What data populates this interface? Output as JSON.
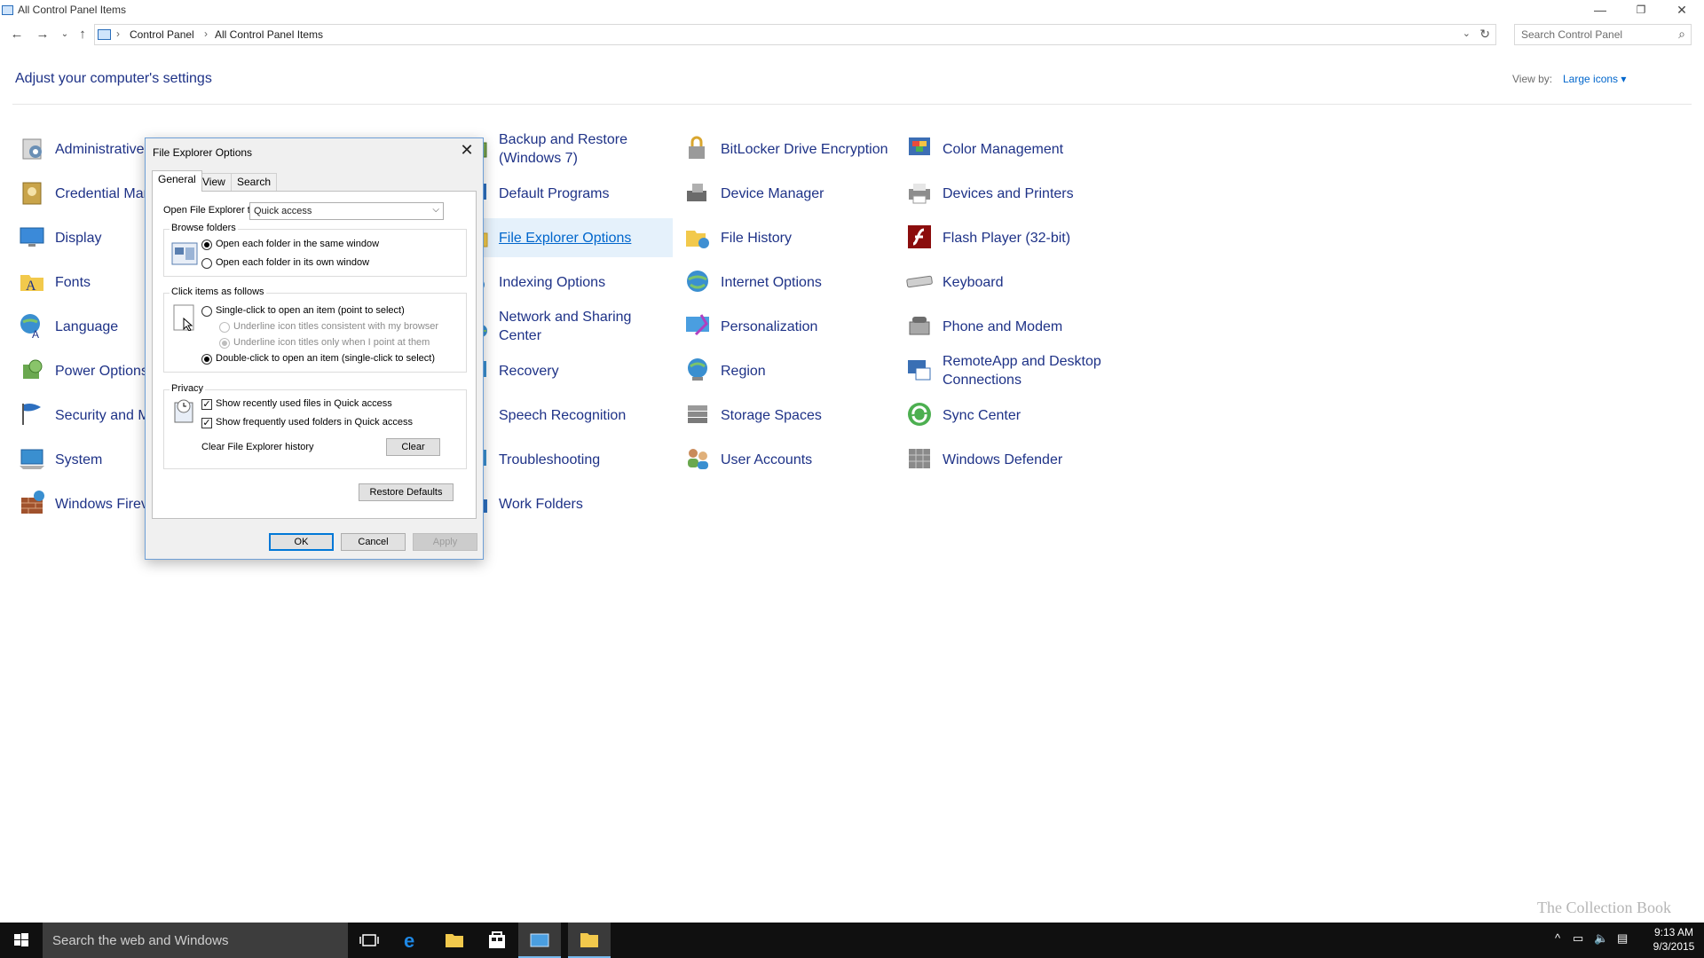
{
  "window": {
    "title": "All Control Panel Items",
    "minimize": "—",
    "restore": "❐",
    "close": "✕"
  },
  "address": {
    "breadcrumbs": [
      "Control Panel",
      "All Control Panel Items"
    ],
    "separator": "›",
    "search_placeholder": "Search Control Panel"
  },
  "header": {
    "heading": "Adjust your computer's settings",
    "view_by_label": "View by:",
    "view_by_value": "Large icons ▾"
  },
  "items": [
    {
      "label": "Administrative",
      "icon": "admin-tools-icon"
    },
    {
      "label": "Backup and Restore (Windows 7)",
      "icon": "backup-icon"
    },
    {
      "label": "BitLocker Drive Encryption",
      "icon": "bitlocker-icon"
    },
    {
      "label": "Color Management",
      "icon": "color-management-icon"
    },
    {
      "label": "Credential Mar",
      "icon": "credential-icon"
    },
    {
      "label": "Default Programs",
      "icon": "default-programs-icon"
    },
    {
      "label": "Device Manager",
      "icon": "device-manager-icon"
    },
    {
      "label": "Devices and Printers",
      "icon": "printer-icon"
    },
    {
      "label": "Display",
      "icon": "display-icon"
    },
    {
      "label": "File Explorer Options",
      "icon": "folder-options-icon"
    },
    {
      "label": "File History",
      "icon": "file-history-icon"
    },
    {
      "label": "Flash Player (32-bit)",
      "icon": "flash-icon"
    },
    {
      "label": "Fonts",
      "icon": "fonts-icon"
    },
    {
      "label": "Indexing Options",
      "icon": "indexing-icon"
    },
    {
      "label": "Internet Options",
      "icon": "internet-icon"
    },
    {
      "label": "Keyboard",
      "icon": "keyboard-icon"
    },
    {
      "label": "Language",
      "icon": "language-icon"
    },
    {
      "label": "Network and Sharing Center",
      "icon": "network-icon"
    },
    {
      "label": "Personalization",
      "icon": "personalization-icon"
    },
    {
      "label": "Phone and Modem",
      "icon": "phone-icon"
    },
    {
      "label": "Power Options",
      "icon": "power-icon"
    },
    {
      "label": "Recovery",
      "icon": "recovery-icon"
    },
    {
      "label": "Region",
      "icon": "region-icon"
    },
    {
      "label": "RemoteApp and Desktop Connections",
      "icon": "remoteapp-icon"
    },
    {
      "label": "Security and M",
      "icon": "flag-icon"
    },
    {
      "label": "Speech Recognition",
      "icon": "speech-icon"
    },
    {
      "label": "Storage Spaces",
      "icon": "storage-icon"
    },
    {
      "label": "Sync Center",
      "icon": "sync-icon"
    },
    {
      "label": "System",
      "icon": "system-icon"
    },
    {
      "label": "Troubleshooting",
      "icon": "troubleshoot-icon"
    },
    {
      "label": "User Accounts",
      "icon": "users-icon"
    },
    {
      "label": "Windows Defender",
      "icon": "defender-icon"
    },
    {
      "label": "Windows Firev",
      "icon": "firewall-icon"
    },
    {
      "label": "Work Folders",
      "icon": "work-folders-icon"
    }
  ],
  "dialog": {
    "title": "File Explorer Options",
    "tabs": [
      "General",
      "View",
      "Search"
    ],
    "open_to_label": "Open File Explorer to:",
    "open_to_value": "Quick access",
    "browse_folders": {
      "label": "Browse folders",
      "same_window": "Open each folder in the same window",
      "own_window": "Open each folder in its own window"
    },
    "click_items": {
      "label": "Click items as follows",
      "single_click": "Single-click to open an item (point to select)",
      "underline_browser": "Underline icon titles consistent with my browser",
      "underline_point": "Underline icon titles only when I point at them",
      "double_click": "Double-click to open an item (single-click to select)"
    },
    "privacy": {
      "label": "Privacy",
      "recent_files": "Show recently used files in Quick access",
      "frequent_folders": "Show frequently used folders in Quick access",
      "clear_history": "Clear File Explorer history",
      "clear_button": "Clear"
    },
    "restore_defaults": "Restore Defaults",
    "ok": "OK",
    "cancel": "Cancel",
    "apply": "Apply"
  },
  "taskbar": {
    "search_placeholder": "Search the web and Windows",
    "time": "9:13 AM",
    "date": "9/3/2015",
    "accent": "#76b9ed"
  },
  "watermark": "The Collection Book"
}
